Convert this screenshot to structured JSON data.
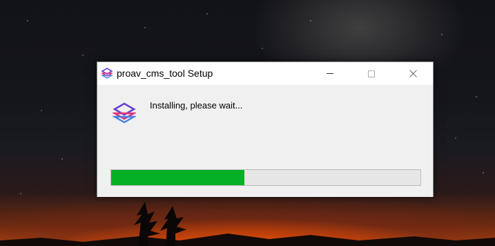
{
  "window": {
    "title": "proav_cms_tool Setup",
    "icon": "layers-cube-icon"
  },
  "titlebar_buttons": {
    "minimize": "—",
    "maximize": "☐",
    "close": "✕"
  },
  "installer": {
    "status_text": "Installing, please wait...",
    "progress_fraction": 0.43
  },
  "colors": {
    "progress_fill": "#06b025",
    "progress_track": "#e6e6e6",
    "icon_purple": "#6a3fd1",
    "icon_pink": "#e0357a"
  }
}
